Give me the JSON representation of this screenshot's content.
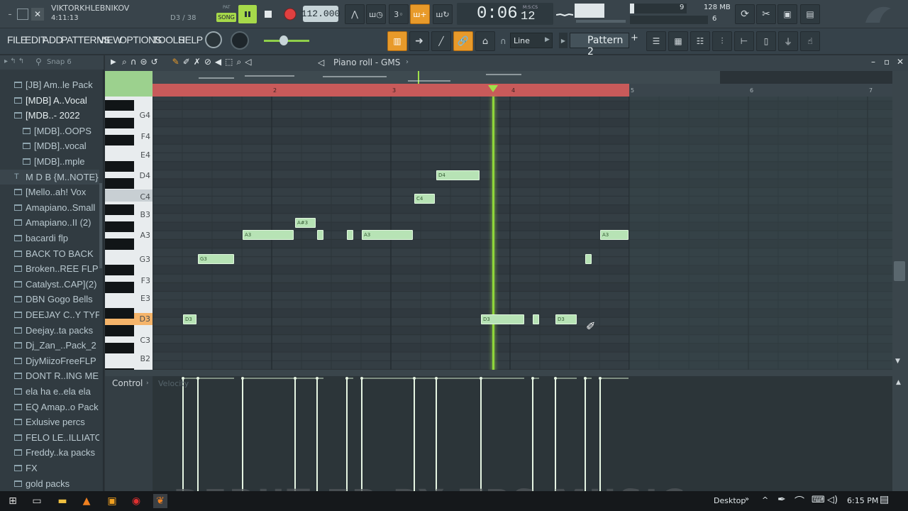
{
  "window": {
    "user": "VIKTORKHLEBNIKOV",
    "time_position": "4:11:13",
    "step_info": "D3 / 38"
  },
  "transport": {
    "song_mode": "SONG",
    "pat_label": "PAT",
    "tempo": "112.000",
    "time_main": "0:06",
    "time_sub": "12",
    "time_format": "M:S:CS"
  },
  "stats": {
    "cpu_value": "9",
    "memory": "128 MB",
    "polyphony": "6"
  },
  "menu": [
    "FILE",
    "EDIT",
    "ADD",
    "PATTERNS",
    "VIEW",
    "OPTIONS",
    "TOOLS",
    "HELP"
  ],
  "snap_mode": "Line",
  "pattern_name": "Pattern 2",
  "browser": {
    "snap_label": "Snap 6",
    "items": [
      {
        "label": "[JB] Am..le Pack",
        "type": "folder"
      },
      {
        "label": "[MDB] A..Vocal",
        "type": "folder"
      },
      {
        "label": "[MDB..- 2022",
        "type": "folder"
      },
      {
        "label": "[MDB]..OOPS",
        "type": "subfolder"
      },
      {
        "label": "[MDB]..vocal",
        "type": "subfolder"
      },
      {
        "label": "[MDB]..mple",
        "type": "subfolder"
      },
      {
        "label": "M D B {M..NOTE}",
        "type": "text"
      },
      {
        "label": "[Mello..ah! Vox",
        "type": "folder"
      },
      {
        "label": "Amapiano..Small",
        "type": "folder"
      },
      {
        "label": "Amapiano..II (2)",
        "type": "folder"
      },
      {
        "label": "bacardi flp",
        "type": "folder"
      },
      {
        "label": "BACK TO BACK",
        "type": "folder"
      },
      {
        "label": "Broken..REE FLP",
        "type": "folder"
      },
      {
        "label": "Catalyst..CAP](2)",
        "type": "folder"
      },
      {
        "label": "DBN Gogo Bells",
        "type": "folder"
      },
      {
        "label": "DEEJAY C..Y TYPE",
        "type": "folder"
      },
      {
        "label": "Deejay..ta packs",
        "type": "folder"
      },
      {
        "label": "Dj_Zan_..Pack_2",
        "type": "folder"
      },
      {
        "label": "DjyMiizoFreeFLP",
        "type": "folder"
      },
      {
        "label": "DONT R..ING ME",
        "type": "folder"
      },
      {
        "label": "ela ha e..ela ela",
        "type": "folder"
      },
      {
        "label": "EQ Amap..o Pack",
        "type": "folder"
      },
      {
        "label": "Exlusive percs",
        "type": "folder"
      },
      {
        "label": "FELO LE..ILLIATO",
        "type": "folder"
      },
      {
        "label": "Freddy..ka packs",
        "type": "folder"
      },
      {
        "label": "FX",
        "type": "folder"
      },
      {
        "label": "gold packs",
        "type": "folder"
      }
    ]
  },
  "piano_roll": {
    "title": "Piano roll - GMS",
    "bar_numbers": [
      "2",
      "3",
      "4",
      "5",
      "6",
      "7"
    ],
    "key_labels": [
      "G4",
      "F4",
      "E4",
      "D4",
      "C4",
      "B3",
      "A3",
      "G3",
      "F3",
      "E3",
      "D3",
      "C3",
      "B2"
    ],
    "notes": [
      {
        "label": "D3"
      },
      {
        "label": "G3"
      },
      {
        "label": "A3"
      },
      {
        "label": "A#3"
      },
      {
        "label": ""
      },
      {
        "label": ""
      },
      {
        "label": "A3"
      },
      {
        "label": "C4"
      },
      {
        "label": "D4"
      },
      {
        "label": "D3"
      },
      {
        "label": ""
      },
      {
        "label": "D3"
      },
      {
        "label": ""
      },
      {
        "label": "A3"
      }
    ]
  },
  "control": {
    "label": "Control",
    "target": "Velocity"
  },
  "taskbar": {
    "desktop": "Desktop",
    "clock": "6:15 PM"
  },
  "watermark": "DEBUT EP BY TPS MUSIC",
  "colors": {
    "accent_orange": "#e89a2a",
    "note_green": "#b7e3b5",
    "loop_red": "#c85a5a",
    "playhead": "#9fe04a",
    "record": "#e04040"
  }
}
